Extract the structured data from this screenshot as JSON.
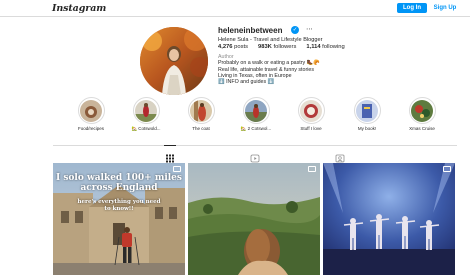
{
  "header": {
    "logo": "Instagram",
    "login_label": "Log In",
    "signup_label": "Sign Up"
  },
  "profile": {
    "username": "heleneinbetween",
    "verified_icon": "verified-badge-icon",
    "more_icon": "more-options-icon",
    "full_name": "Helene Sula - Travel and Lifestyle Blogger",
    "posts_count": "4,276",
    "posts_label": "posts",
    "followers_count": "983K",
    "followers_label": "followers",
    "following_count": "1,114",
    "following_label": "following",
    "bio_category": "Author",
    "bio_lines": [
      "Probably on a walk or eating a pastry 🥾🥐",
      "Real life, attainable travel & funny stories",
      "Living in Texas, often in Europe",
      "⬇️ INFO and guides ⬇️"
    ]
  },
  "highlights": [
    {
      "label": "Food/recipes"
    },
    {
      "label": "🏡 Cotswold..."
    },
    {
      "label": "The coat"
    },
    {
      "label": "🏡 2 Cotswol..."
    },
    {
      "label": "Stuff I love"
    },
    {
      "label": "My book!"
    },
    {
      "label": "Xmas Cruise"
    }
  ],
  "tabs": [
    {
      "name": "posts",
      "icon": "grid-icon"
    },
    {
      "name": "reels",
      "icon": "reels-icon"
    },
    {
      "name": "tagged",
      "icon": "tagged-icon"
    }
  ],
  "posts": [
    {
      "overlay_title": "I solo walked 100+ miles across England",
      "overlay_subtitle": "here's everything you need to know!!",
      "badge_icon": "carousel-icon"
    },
    {
      "badge_icon": "carousel-icon"
    },
    {
      "badge_icon": "carousel-icon"
    }
  ],
  "colors": {
    "accent": "#0095f6",
    "text": "#262626",
    "muted": "#8e8e8e",
    "border": "#dbdbdb"
  }
}
